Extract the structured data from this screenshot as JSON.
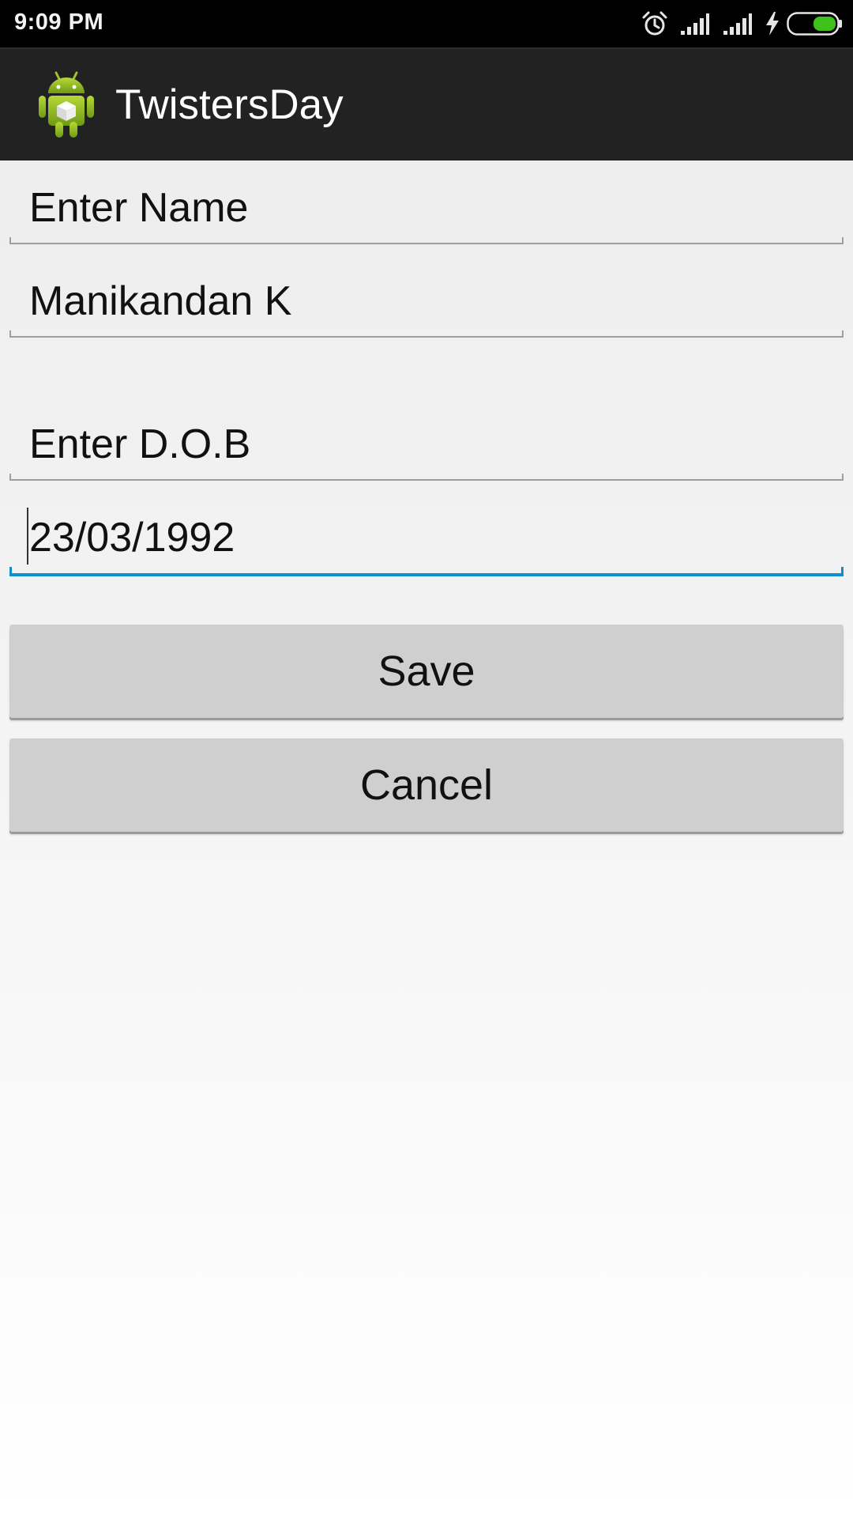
{
  "status_bar": {
    "time": "9:09 PM",
    "icons": [
      "alarm-icon",
      "signal-icon",
      "signal-icon",
      "charging-icon",
      "battery-icon"
    ],
    "battery_color": "#3ec21b"
  },
  "action_bar": {
    "app_title": "TwistersDay",
    "logo_icon": "android-app-icon",
    "background": "#222222"
  },
  "form": {
    "name_label": "Enter Name",
    "name_value": "Manikandan K",
    "dob_label": "Enter D.O.B",
    "dob_value": "23/03/1992",
    "focus_color": "#0e8fd0"
  },
  "buttons": {
    "save_label": "Save",
    "cancel_label": "Cancel"
  }
}
